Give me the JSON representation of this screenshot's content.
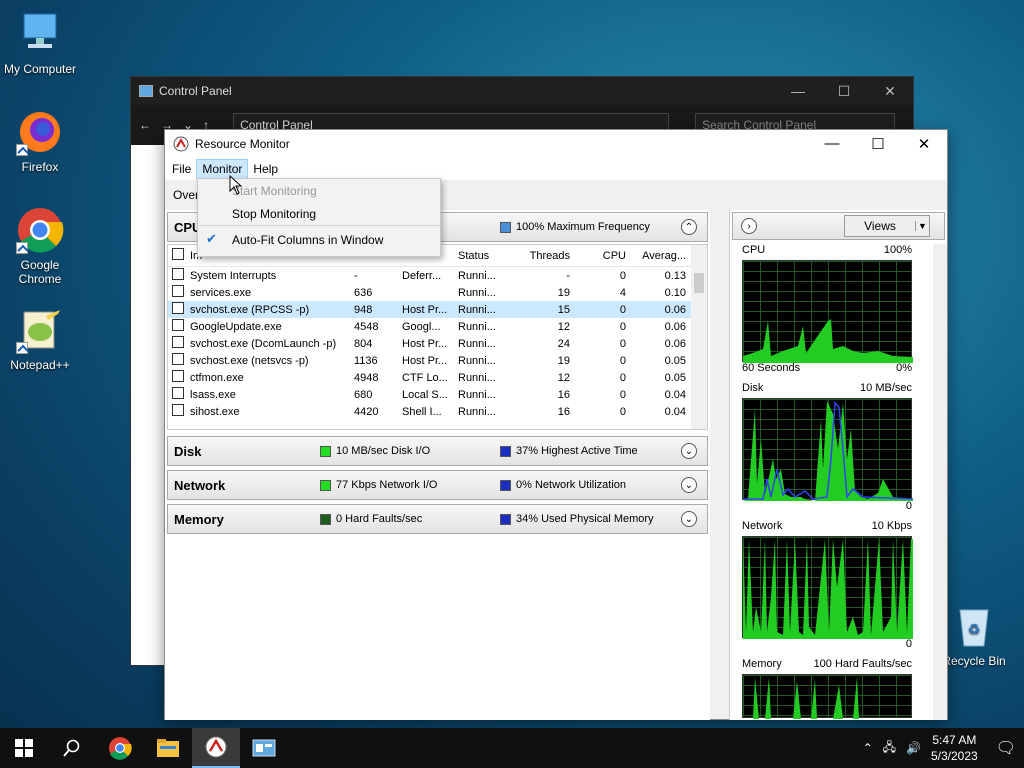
{
  "desktop": {
    "icons": [
      {
        "label": "My Computer"
      },
      {
        "label": "Firefox"
      },
      {
        "label": "Google Chrome"
      },
      {
        "label": "Notepad++"
      },
      {
        "label": "Recycle Bin"
      }
    ]
  },
  "control_panel": {
    "title": "Control Panel",
    "address": "Control Panel",
    "search_placeholder": "Search Control Panel"
  },
  "resource_monitor": {
    "title": "Resource Monitor",
    "menu": [
      "File",
      "Monitor",
      "Help"
    ],
    "tab_overview": "Over",
    "monitor_menu": {
      "start": "Start Monitoring",
      "stop": "Stop Monitoring",
      "autofit": "Auto-Fit Columns in Window"
    },
    "cpu": {
      "name": "CPU",
      "legend2": "100% Maximum Frequency",
      "columns": [
        "Im",
        "Status",
        "Threads",
        "CPU",
        "Averag..."
      ],
      "rows": [
        {
          "name": "System Interrupts",
          "pid": "-",
          "desc": "Deferr...",
          "status": "Runni...",
          "threads": "-",
          "cpu": "0",
          "avg": "0.13"
        },
        {
          "name": "services.exe",
          "pid": "636",
          "desc": "",
          "status": "Runni...",
          "threads": "19",
          "cpu": "4",
          "avg": "0.10"
        },
        {
          "name": "svchost.exe (RPCSS -p)",
          "pid": "948",
          "desc": "Host Pr...",
          "status": "Runni...",
          "threads": "15",
          "cpu": "0",
          "avg": "0.06"
        },
        {
          "name": "GoogleUpdate.exe",
          "pid": "4548",
          "desc": "Googl...",
          "status": "Runni...",
          "threads": "12",
          "cpu": "0",
          "avg": "0.06"
        },
        {
          "name": "svchost.exe (DcomLaunch -p)",
          "pid": "804",
          "desc": "Host Pr...",
          "status": "Runni...",
          "threads": "24",
          "cpu": "0",
          "avg": "0.06"
        },
        {
          "name": "svchost.exe (netsvcs -p)",
          "pid": "1136",
          "desc": "Host Pr...",
          "status": "Runni...",
          "threads": "19",
          "cpu": "0",
          "avg": "0.05"
        },
        {
          "name": "ctfmon.exe",
          "pid": "4948",
          "desc": "CTF Lo...",
          "status": "Runni...",
          "threads": "12",
          "cpu": "0",
          "avg": "0.05"
        },
        {
          "name": "lsass.exe",
          "pid": "680",
          "desc": "Local S...",
          "status": "Runni...",
          "threads": "16",
          "cpu": "0",
          "avg": "0.04"
        },
        {
          "name": "sihost.exe",
          "pid": "4420",
          "desc": "Shell I...",
          "status": "Runni...",
          "threads": "16",
          "cpu": "0",
          "avg": "0.04"
        }
      ]
    },
    "disk": {
      "name": "Disk",
      "legend1": "10 MB/sec Disk I/O",
      "legend2": "37% Highest Active Time"
    },
    "network": {
      "name": "Network",
      "legend1": "77 Kbps Network I/O",
      "legend2": "0% Network Utilization"
    },
    "memory": {
      "name": "Memory",
      "legend1": "0 Hard Faults/sec",
      "legend2": "34% Used Physical Memory"
    },
    "views_label": "Views",
    "graphs": {
      "cpu": {
        "label": "CPU",
        "max": "100%",
        "foot_left": "60 Seconds",
        "foot_right": "0%"
      },
      "disk": {
        "label": "Disk",
        "max": "10 MB/sec",
        "foot_right": "0"
      },
      "network": {
        "label": "Network",
        "max": "10 Kbps",
        "foot_right": "0"
      },
      "memory": {
        "label": "Memory",
        "max": "100 Hard Faults/sec"
      }
    }
  },
  "taskbar": {
    "time": "5:47 AM",
    "date": "5/3/2023"
  },
  "colors": {
    "green_legend": "#22dd22",
    "blue_legend": "#1a2fbf",
    "dark_green_legend": "#1d5c1d"
  }
}
